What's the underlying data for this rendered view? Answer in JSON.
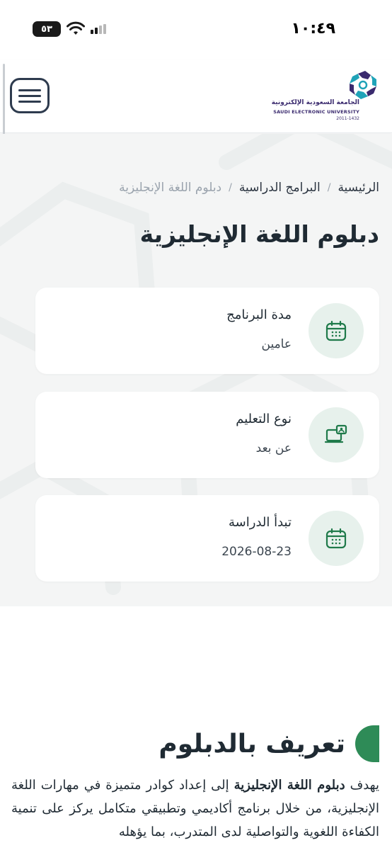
{
  "status_bar": {
    "time": "١٠:٤٩",
    "battery": "٥٣"
  },
  "header": {
    "logo": {
      "arabic_name": "الجامعة السعودية الإلكترونية",
      "english_name": "SAUDI ELECTRONIC UNIVERSITY",
      "years": "2011-1432"
    },
    "menu_icon": "hamburger-icon"
  },
  "breadcrumb": {
    "home": "الرئيسية",
    "programs": "البرامج الدراسية",
    "current": "دبلوم اللغة الإنجليزية",
    "separator": "/"
  },
  "page_title": "دبلوم اللغة الإنجليزية",
  "info_cards": [
    {
      "label": "مدة البرنامج",
      "value": "عامين",
      "icon": "calendar-icon"
    },
    {
      "label": "نوع التعليم",
      "value": "عن بعد",
      "icon": "remote-learning-icon"
    },
    {
      "label": "تبدأ الدراسة",
      "value": "2026-08-23",
      "icon": "calendar-icon"
    }
  ],
  "definition": {
    "title": "تعريف بالدبلوم",
    "intro_verb": "يهدف",
    "program_name": "دبلوم اللغة الإنجليزية",
    "body": "إلى إعداد كوادر متميزة في مهارات اللغة الإنجليزية، من خلال برنامج أكاديمي وتطبيقي متكامل يركز على تنمية الكفاءة اللغوية والتواصلية لدى المتدرب، بما يؤهله"
  },
  "colors": {
    "accent": "#2e8b57",
    "icon_bg": "#e7f1ec",
    "hero_bg": "#f4f5f5",
    "logo": "#3a2a6e"
  }
}
